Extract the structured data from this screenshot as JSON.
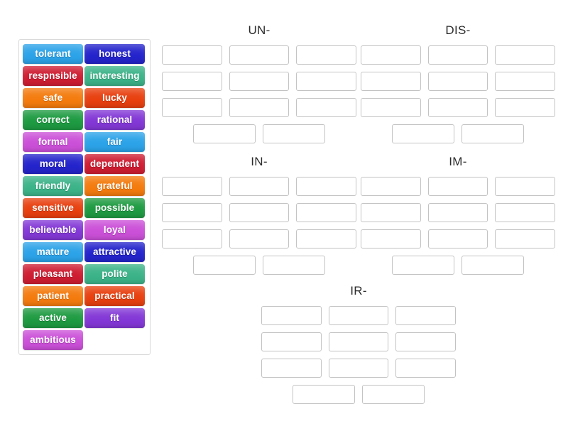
{
  "word_bank": {
    "name": "word-bank",
    "tiles": [
      {
        "label": "tolerant",
        "color": "#2ca3e8"
      },
      {
        "label": "honest",
        "color": "#2424cc"
      },
      {
        "label": "respnsible",
        "color": "#cf1d32"
      },
      {
        "label": "interesting",
        "color": "#3cb389"
      },
      {
        "label": "safe",
        "color": "#f47b0e"
      },
      {
        "label": "lucky",
        "color": "#e8400f"
      },
      {
        "label": "correct",
        "color": "#1e9b42"
      },
      {
        "label": "rational",
        "color": "#8338d6"
      },
      {
        "label": "formal",
        "color": "#cb50d8"
      },
      {
        "label": "fair",
        "color": "#2ca3e8"
      },
      {
        "label": "moral",
        "color": "#2424cc"
      },
      {
        "label": "dependent",
        "color": "#cf1d32"
      },
      {
        "label": "friendly",
        "color": "#3cb389"
      },
      {
        "label": "grateful",
        "color": "#f47b0e"
      },
      {
        "label": "sensitive",
        "color": "#e8400f"
      },
      {
        "label": "possible",
        "color": "#1e9b42"
      },
      {
        "label": "believable",
        "color": "#8338d6"
      },
      {
        "label": "loyal",
        "color": "#cb50d8"
      },
      {
        "label": "mature",
        "color": "#2ca3e8"
      },
      {
        "label": "attractive",
        "color": "#2424cc"
      },
      {
        "label": "pleasant",
        "color": "#cf1d32"
      },
      {
        "label": "polite",
        "color": "#3cb389"
      },
      {
        "label": "patient",
        "color": "#f47b0e"
      },
      {
        "label": "practical",
        "color": "#e8400f"
      },
      {
        "label": "active",
        "color": "#1e9b42"
      },
      {
        "label": "fit",
        "color": "#8338d6"
      },
      {
        "label": "ambitious",
        "color": "#cb50d8"
      }
    ]
  },
  "groups": [
    {
      "id": "group-un",
      "title": "UN-",
      "rows": [
        3,
        3,
        3,
        2
      ]
    },
    {
      "id": "group-dis",
      "title": "DIS-",
      "rows": [
        3,
        3,
        3,
        2
      ]
    },
    {
      "id": "group-in",
      "title": "IN-",
      "rows": [
        3,
        3,
        3,
        2
      ]
    },
    {
      "id": "group-im",
      "title": "IM-",
      "rows": [
        3,
        3,
        3,
        2
      ]
    },
    {
      "id": "group-ir",
      "title": "IR-",
      "rows": [
        3,
        3,
        3,
        2
      ]
    }
  ],
  "theme": {
    "background": "#ffffff",
    "slot_border": "#c3c3c3",
    "panel_border": "#d8d8d8",
    "title_color": "#2b2b2b",
    "tile_text_color": "#ffffff"
  }
}
